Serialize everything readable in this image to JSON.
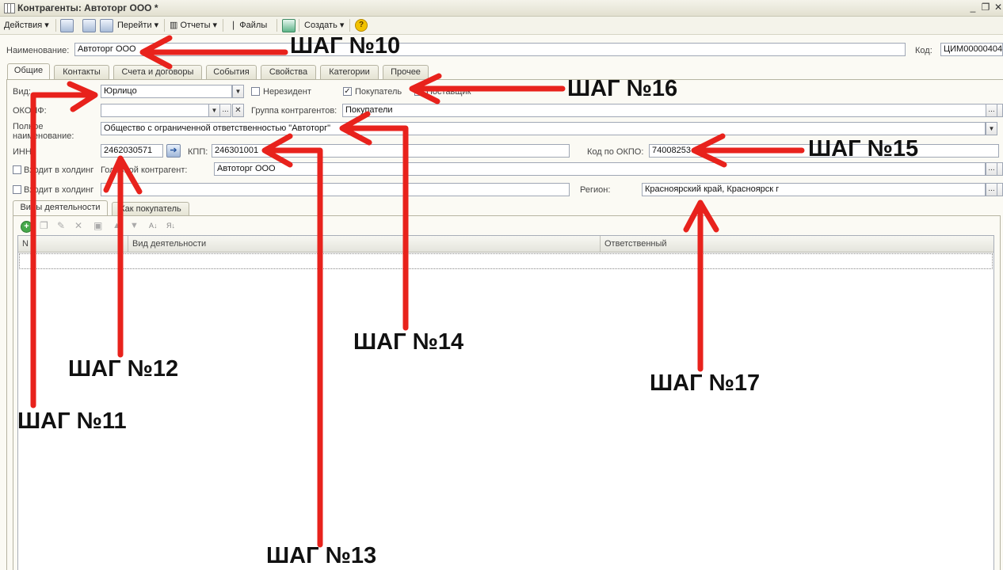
{
  "window": {
    "title": "Контрагенты: Автоторг ООО *"
  },
  "toolbar": {
    "actions": "Действия",
    "goto": "Перейти",
    "reports": "Отчеты",
    "files": "Файлы",
    "create": "Создать"
  },
  "header": {
    "name_label": "Наименование:",
    "name_value": "Автоторг ООО",
    "code_label": "Код:",
    "code_value": "ЦИМ00000404"
  },
  "tabs": [
    "Общие",
    "Контакты",
    "Счета и договоры",
    "События",
    "Свойства",
    "Категории",
    "Прочее"
  ],
  "form": {
    "vid_label": "Вид:",
    "vid_value": "Юрлицо",
    "nonresident_label": "Нерезидент",
    "buyer_label": "Покупатель",
    "supplier_label": "Поставщик",
    "okopf_label": "ОКОПФ:",
    "group_label": "Группа контрагентов:",
    "group_value": "Покупатели",
    "fullname_label": "Полное наименование:",
    "fullname_value": "Общество с ограниченной ответственностью \"Автоторг\"",
    "inn_label": "ИНН:",
    "inn_value": "2462030571",
    "kpp_label": "КПП:",
    "kpp_value": "246301001",
    "okpo_label": "Код по ОКПО:",
    "okpo_value": "74008253",
    "holding_label": "Входит в холдинг",
    "head_label": "Головной контрагент:",
    "head_value": "Автоторг ООО",
    "holding2_label": "Входит в холдинг",
    "region_label": "Регион:",
    "region_value": "Красноярский край, Красноярск г"
  },
  "subtabs": [
    "Виды деятельности",
    "Как покупатель"
  ],
  "grid": {
    "columns": [
      "N",
      "Вид деятельности",
      "Ответственный"
    ]
  },
  "annotations": {
    "step10": "ШАГ №10",
    "step11": "ШАГ №11",
    "step12": "ШАГ №12",
    "step13": "ШАГ №13",
    "step14": "ШАГ №14",
    "step15": "ШАГ №15",
    "step16": "ШАГ №16",
    "step17": "ШАГ №17",
    "arrow_color": "#e8221c"
  }
}
